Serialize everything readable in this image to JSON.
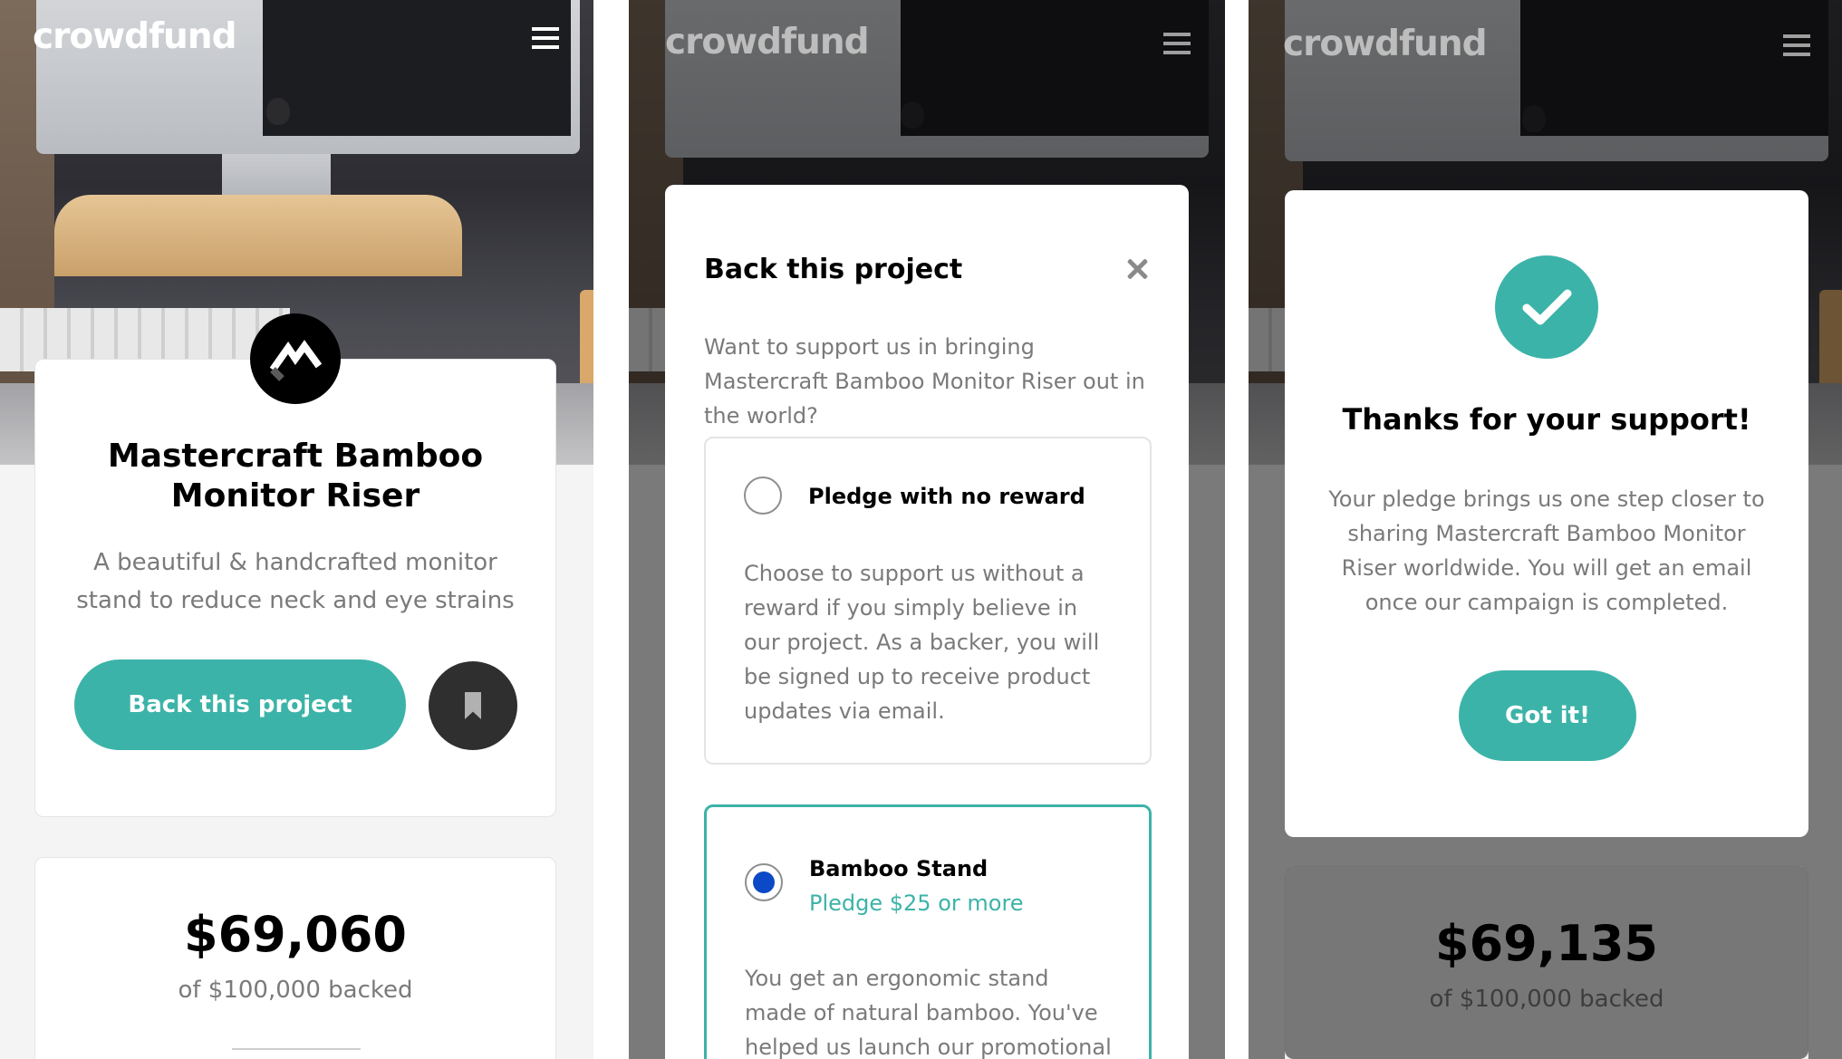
{
  "brand": {
    "logo": "crowdfund",
    "accent_color": "#3cb3a8",
    "menu_icon": "hamburger-icon"
  },
  "screen1": {
    "project_title": "Mastercraft Bamboo Monitor Riser",
    "project_desc": "A beautiful & handcrafted monitor stand to reduce neck and eye strains",
    "back_button": "Back this project",
    "bookmark_icon": "bookmark-icon",
    "amount": "$69,060",
    "amount_sub": "of $100,000 backed"
  },
  "screen2": {
    "modal_title": "Back this project",
    "modal_desc": "Want to support us in bringing Mastercraft Bamboo Monitor Riser out in the world?",
    "close_icon": "close-icon",
    "pledges": [
      {
        "name": "Pledge with no reward",
        "min": "",
        "desc": "Choose to support us without a reward if you simply believe in our project. As a backer, you will be signed up to receive product updates via email.",
        "selected": false
      },
      {
        "name": "Bamboo Stand",
        "min": "Pledge $25 or more",
        "desc": "You get an ergonomic stand made of natural bamboo. You've helped us launch our promotional",
        "selected": true
      }
    ]
  },
  "screen3": {
    "check_icon": "check-icon",
    "success_title": "Thanks for your support!",
    "success_desc": "Your pledge brings us one step closer to sharing Mastercraft Bamboo Monitor Riser worldwide. You will get an email once our campaign is completed.",
    "got_it": "Got it!",
    "amount": "$69,135",
    "amount_sub": "of $100,000 backed"
  }
}
